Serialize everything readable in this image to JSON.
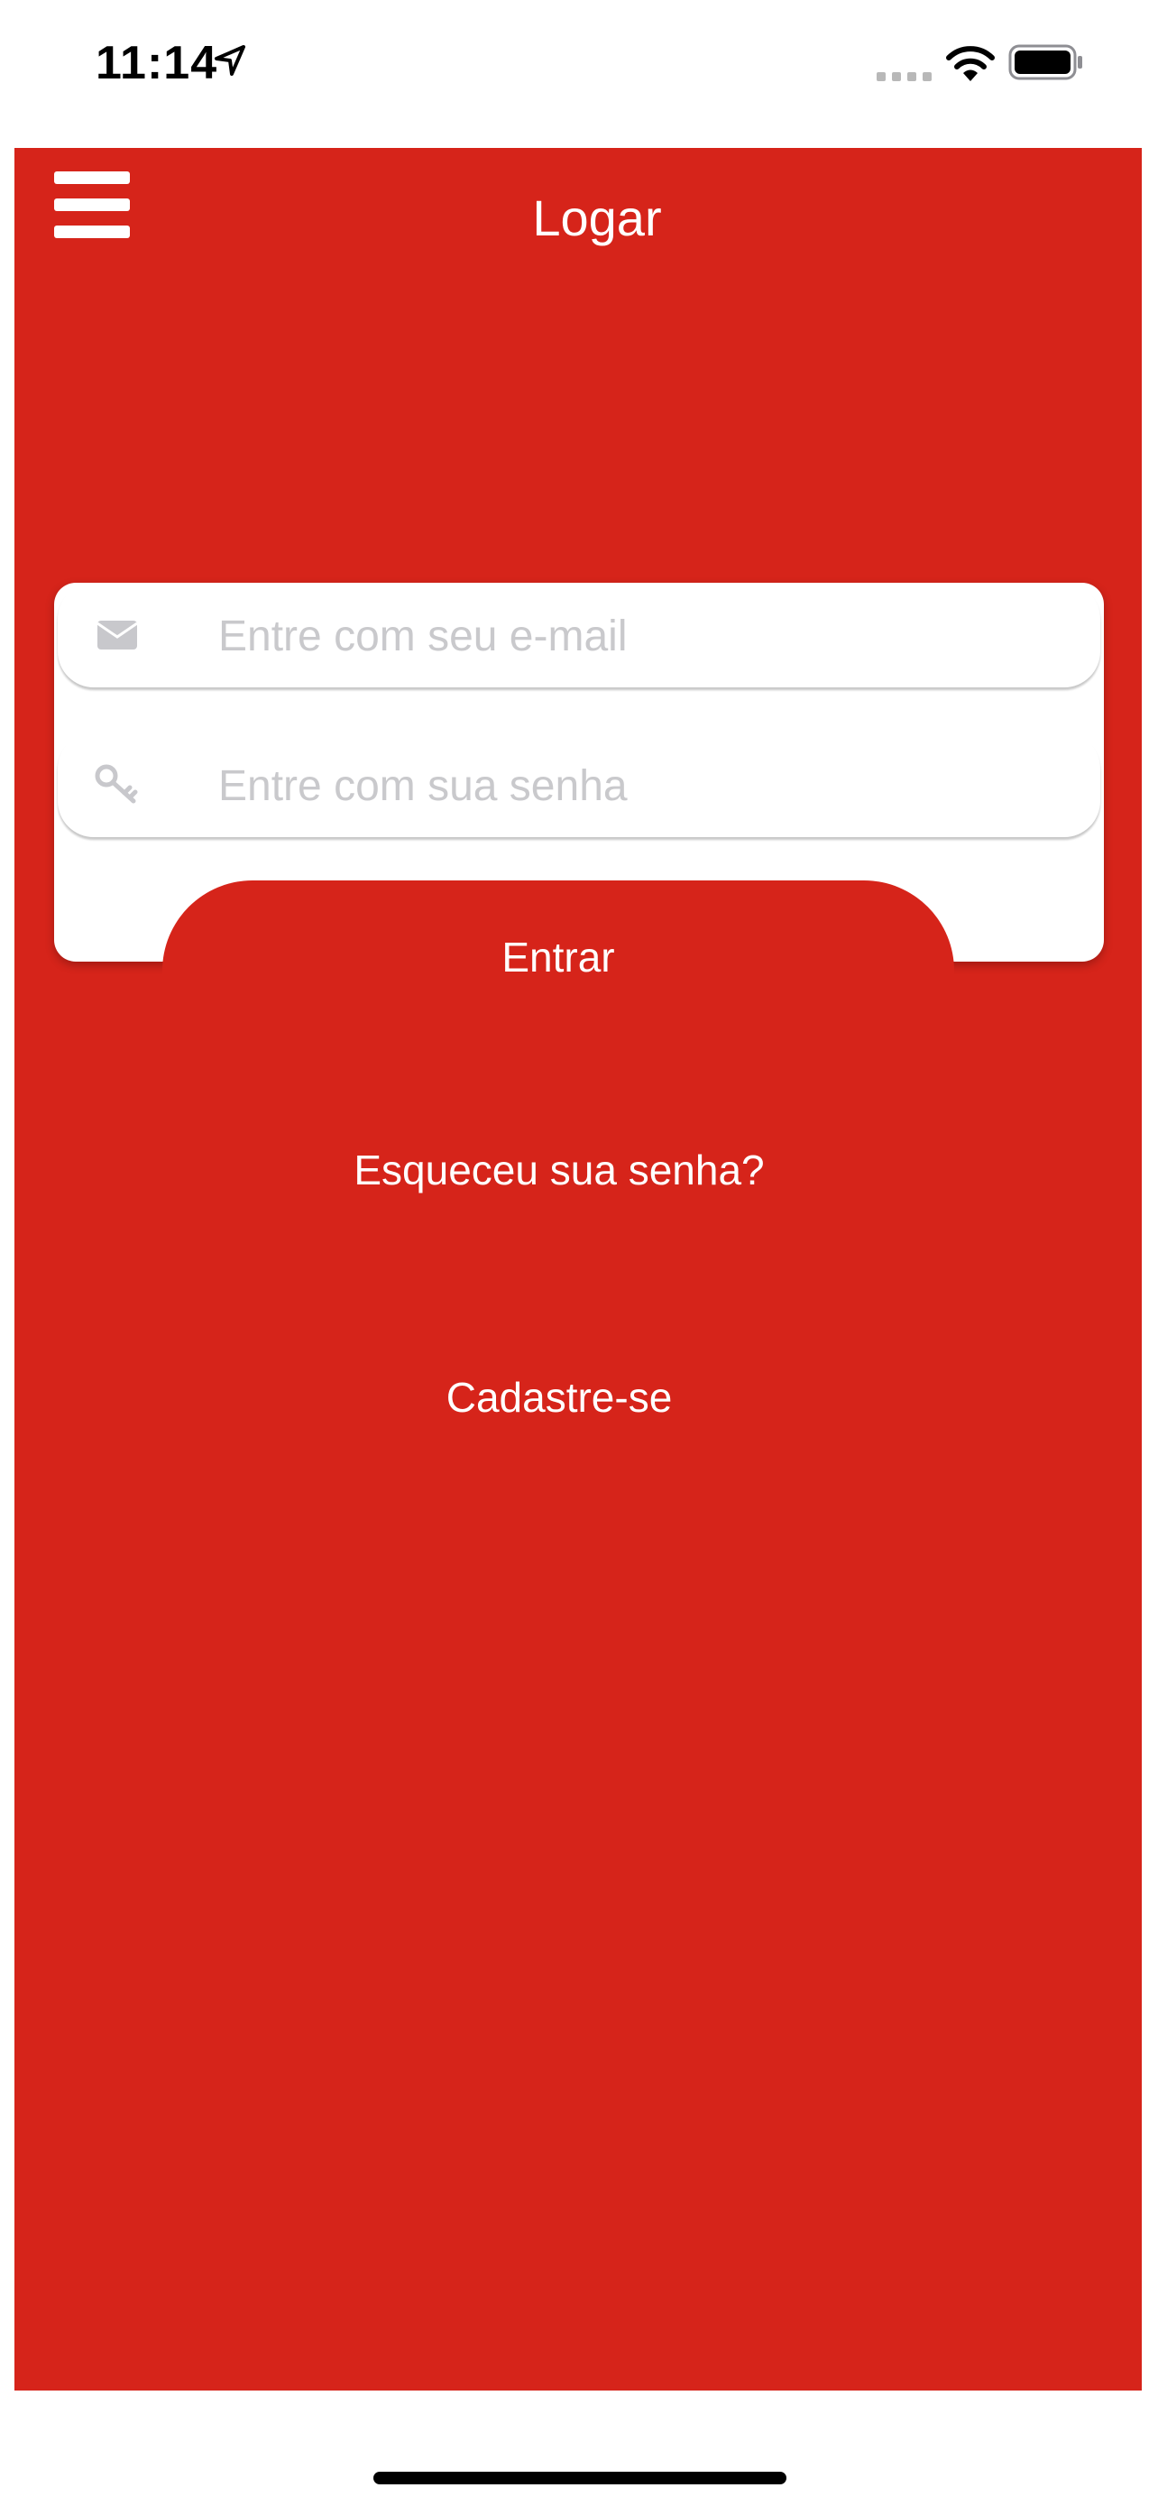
{
  "status_bar": {
    "time": "11:14",
    "icons": [
      "location-arrow-icon",
      "cellular-signal-icon",
      "wifi-icon",
      "battery-icon"
    ]
  },
  "header": {
    "menu_icon": "hamburger-menu-icon",
    "title": "Logar"
  },
  "login_form": {
    "email": {
      "icon": "envelope-icon",
      "placeholder": "Entre com seu e-mail",
      "value": ""
    },
    "password": {
      "icon": "key-icon",
      "placeholder": "Entre com sua senha",
      "value": ""
    },
    "submit_label": "Entrar"
  },
  "links": {
    "forgot_password": "Esqueceu sua senha?",
    "sign_up": "Cadastre-se"
  },
  "colors": {
    "brand_red": "#d6241a",
    "placeholder_gray": "#c9c9cc",
    "icon_gray": "#c8c8cc"
  }
}
